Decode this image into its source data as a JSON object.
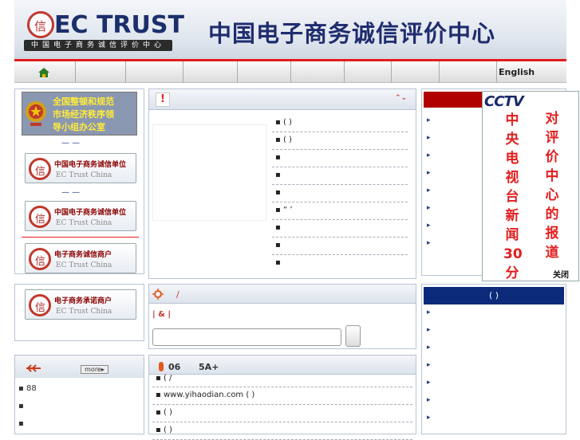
{
  "header": {
    "logo_text": "EC TRUST",
    "logo_sub": "中国电子商务诚信评价中心",
    "title": "中国电子商务诚信评价中心",
    "logo_glyph": "信"
  },
  "nav": {
    "english": "English"
  },
  "left": {
    "banner_lines": [
      "全国整顿和规范",
      "市场经济秩序领",
      "导小组办公室"
    ],
    "dash1": "— —",
    "badges": [
      {
        "t1": "中国电子商务诚信单位",
        "t2": "EC Trust China"
      },
      {
        "t1": "中国电子商务诚信单位",
        "t2": "EC Trust China"
      },
      {
        "t1": "电子商务诚信商户",
        "t2": "EC Trust China"
      },
      {
        "t1": "电子商务承诺商户",
        "t2": "EC Trust China"
      }
    ],
    "dash2": "— —",
    "more_label": "more▸",
    "bottom_items": [
      "88",
      "",
      ""
    ]
  },
  "middle": {
    "news_items": [
      "( )",
      "( )",
      "",
      "",
      "",
      "“ ’",
      "",
      "",
      ""
    ],
    "search_title": "/",
    "search_links": "|  &  |",
    "search_value": "",
    "bottom_header_num": "06",
    "bottom_header_rank": "5A+",
    "bottom_items": [
      "( /",
      "www.yihaodian.com ( )",
      "( )",
      "( )"
    ]
  },
  "right": {
    "items": [
      "",
      "",
      "",
      "",
      "",
      "",
      "",
      ""
    ],
    "header2": "( )",
    "items2": [
      "",
      "",
      "",
      "",
      "",
      "",
      ""
    ]
  },
  "cctv": {
    "logo": "CCTV",
    "col1": [
      "中",
      "央",
      "电",
      "视",
      "台",
      "新",
      "闻",
      "30",
      "分"
    ],
    "col2": [
      "对",
      "评",
      "价",
      "中",
      "心",
      "的",
      "报",
      "道"
    ],
    "close": "关闭"
  },
  "colors": {
    "accent_red": "#e31d1d",
    "navy": "#1f2d6e",
    "blue_bar": "#0b2a7a"
  }
}
